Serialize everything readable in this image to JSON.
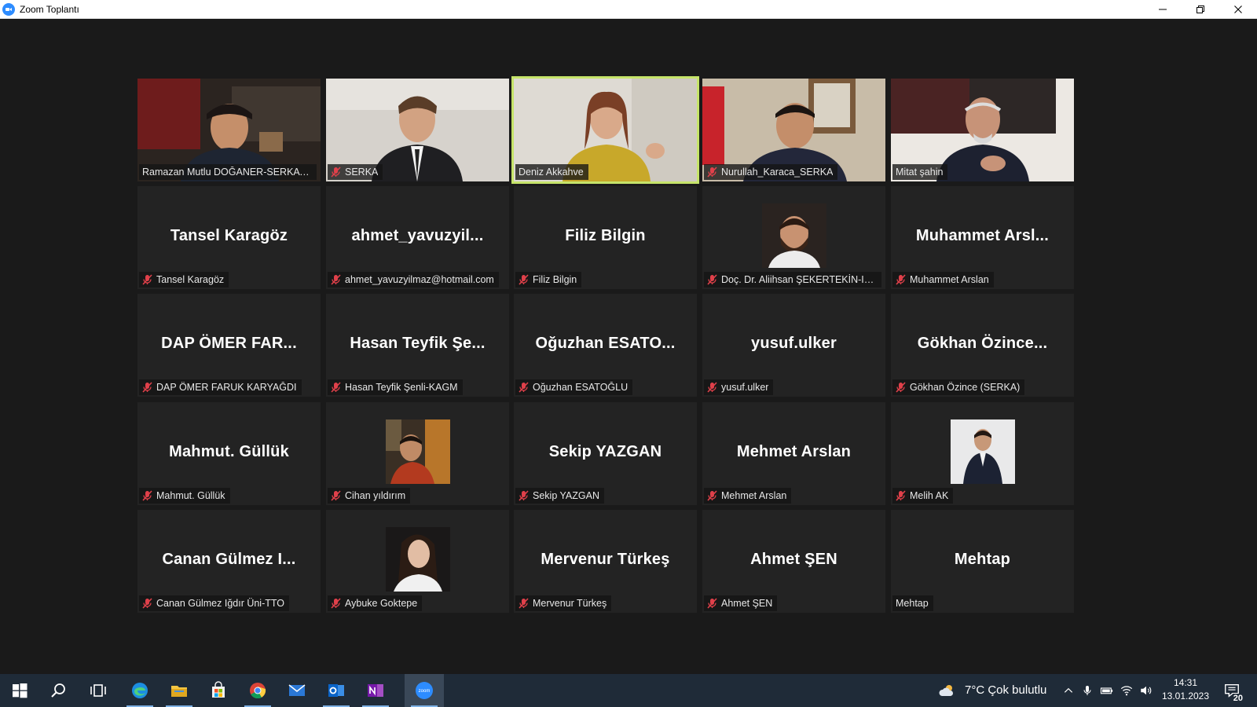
{
  "window": {
    "title": "Zoom Toplantı"
  },
  "colors": {
    "active_speaker_border": "#c6e46a",
    "mic_muted": "#e0404a",
    "zoom_blue": "#2d8cff"
  },
  "tiles": [
    {
      "label": "Ramazan Mutlu DOĞANER-SERKA Iğ...",
      "muted": false,
      "kind": "video",
      "active": false
    },
    {
      "label": "SERKA",
      "muted": true,
      "kind": "video",
      "active": false
    },
    {
      "label": "Deniz Akkahve",
      "muted": false,
      "kind": "video",
      "active": true
    },
    {
      "label": "Nurullah_Karaca_SERKA",
      "muted": true,
      "kind": "video",
      "active": false
    },
    {
      "label": "Mitat şahin",
      "muted": false,
      "kind": "video",
      "active": false
    },
    {
      "display": "Tansel Karagöz",
      "label": "Tansel Karagöz",
      "muted": true,
      "kind": "name"
    },
    {
      "display": "ahmet_yavuzyil...",
      "label": "ahmet_yavuzyilmaz@hotmail.com",
      "muted": true,
      "kind": "name"
    },
    {
      "display": "Filiz Bilgin",
      "label": "Filiz Bilgin",
      "muted": true,
      "kind": "name"
    },
    {
      "label": "Doç. Dr. Aliihsan ŞEKERTEKİN-Iğdır...",
      "muted": true,
      "kind": "photo",
      "photo": "man-beard"
    },
    {
      "display": "Muhammet  Arsl...",
      "label": "Muhammet Arslan",
      "muted": true,
      "kind": "name"
    },
    {
      "display": "DAP ÖMER FAR...",
      "label": "DAP ÖMER FARUK KARYAĞDI",
      "muted": true,
      "kind": "name"
    },
    {
      "display": "Hasan  Teyfik  Şe...",
      "label": "Hasan Teyfik Şenli-KAGM",
      "muted": true,
      "kind": "name"
    },
    {
      "display": "Oğuzhan  ESATO...",
      "label": "Oğuzhan ESATOĞLU",
      "muted": true,
      "kind": "name"
    },
    {
      "display": "yusuf.ulker",
      "label": "yusuf.ulker",
      "muted": true,
      "kind": "name"
    },
    {
      "display": "Gökhan  Özince...",
      "label": "Gökhan Özince (SERKA)",
      "muted": true,
      "kind": "name"
    },
    {
      "display": "Mahmut. Güllük",
      "label": "Mahmut. Güllük",
      "muted": true,
      "kind": "name"
    },
    {
      "label": "Cihan yıldırım",
      "muted": true,
      "kind": "photo",
      "photo": "man-car"
    },
    {
      "display": "Sekip YAZGAN",
      "label": "Sekip YAZGAN",
      "muted": true,
      "kind": "name"
    },
    {
      "display": "Mehmet Arslan",
      "label": "Mehmet Arslan",
      "muted": true,
      "kind": "name"
    },
    {
      "label": "Melih AK",
      "muted": true,
      "kind": "photo",
      "photo": "man-suit"
    },
    {
      "display": "Canan  Gülmez  I...",
      "label": "Canan Gülmez Iğdır Üni-TTO",
      "muted": true,
      "kind": "name"
    },
    {
      "label": "Aybuke Goktepe",
      "muted": true,
      "kind": "photo",
      "photo": "woman"
    },
    {
      "display": "Mervenur Türkeş",
      "label": "Mervenur Türkeş",
      "muted": true,
      "kind": "name"
    },
    {
      "display": "Ahmet ŞEN",
      "label": "Ahmet ŞEN",
      "muted": true,
      "kind": "name"
    },
    {
      "display": "Mehtap",
      "label": "Mehtap",
      "muted": false,
      "kind": "name"
    }
  ],
  "taskbar": {
    "icons": [
      "windows-start-icon",
      "search-icon",
      "task-view-icon",
      "edge-icon",
      "file-explorer-icon",
      "store-icon",
      "chrome-icon",
      "mail-icon",
      "outlook-icon",
      "onenote-icon",
      "zoom-icon"
    ],
    "weather": "7°C  Çok bulutlu",
    "time": "14:31",
    "date": "13.01.2023",
    "notification_count": "20",
    "zoom_label": "zoom"
  }
}
